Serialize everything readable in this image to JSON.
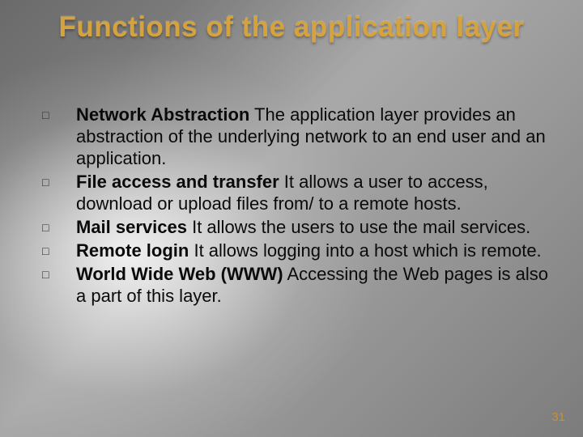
{
  "title": "Functions of the application layer",
  "bullets": [
    {
      "term": "Network Abstraction",
      "desc": " The application layer provides an abstraction of the underlying network to an end user and an application."
    },
    {
      "term": "File access and transfer",
      "desc": " It allows a user to access, download or upload files from/ to a remote hosts."
    },
    {
      "term": "Mail services",
      "desc": " It allows the users to use the mail services."
    },
    {
      "term": "Remote login",
      "desc": " It allows logging into a host which is remote."
    },
    {
      "term": "World Wide Web (WWW)",
      "desc": " Accessing the Web pages is also a part of this layer."
    }
  ],
  "pageNumber": "31",
  "bulletGlyph": "□"
}
